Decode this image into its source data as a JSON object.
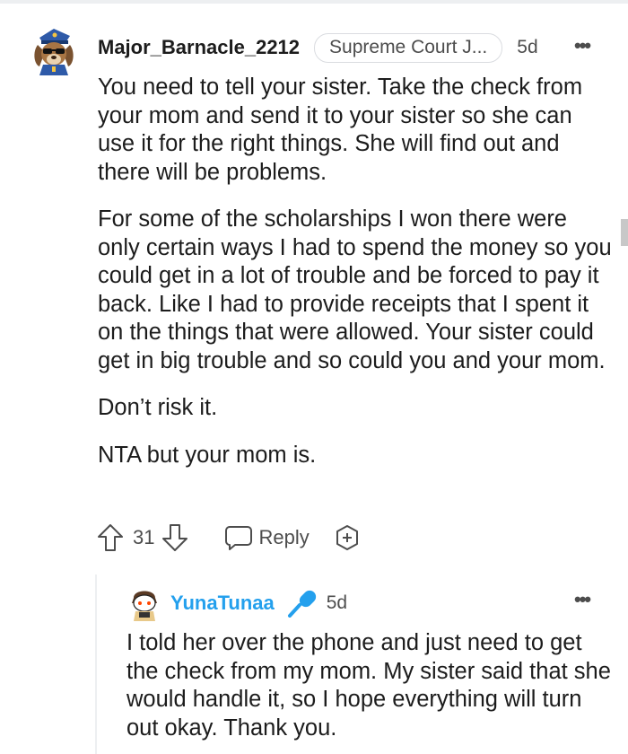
{
  "comment": {
    "username": "Major_Barnacle_2212",
    "flair": "Supreme Court J...",
    "age": "5d",
    "more_label": "•••",
    "paragraphs": [
      "You need to tell your sister. Take the check from your mom and send it to your sister so she can use it for the right things. She will find out and there will be problems.",
      "For some of the scholarships I won there were only certain ways I had to spend the money so you could get in a lot of trouble and be forced to pay it back. Like I had to provide receipts that I spent it on the things that were allowed. Your sister could get in big trouble and so could you and your mom.",
      "Don’t risk it.",
      "NTA but your mom is."
    ],
    "score": "31",
    "reply_label": "Reply",
    "icons": {
      "upvote": "arrow-up-icon",
      "downvote": "arrow-down-icon",
      "reply": "speech-bubble-icon",
      "award": "award-plus-icon",
      "avatar": "police-dog-avatar"
    },
    "colors": {
      "text": "#1c1c1c",
      "meta": "#4d4d4d",
      "flair_border": "#dadce0"
    }
  },
  "reply": {
    "username": "YunaTunaa",
    "age": "5d",
    "more_label": "•••",
    "text": "I told her over the phone and just need to get the check from my mom. My sister said that she would handle it, so I hope everything will turn out okay. Thank you.",
    "icons": {
      "op_badge": "microphone-icon",
      "avatar": "snoo-avatar"
    },
    "colors": {
      "username": "#24a0ed",
      "badge": "#24a0ed"
    }
  }
}
